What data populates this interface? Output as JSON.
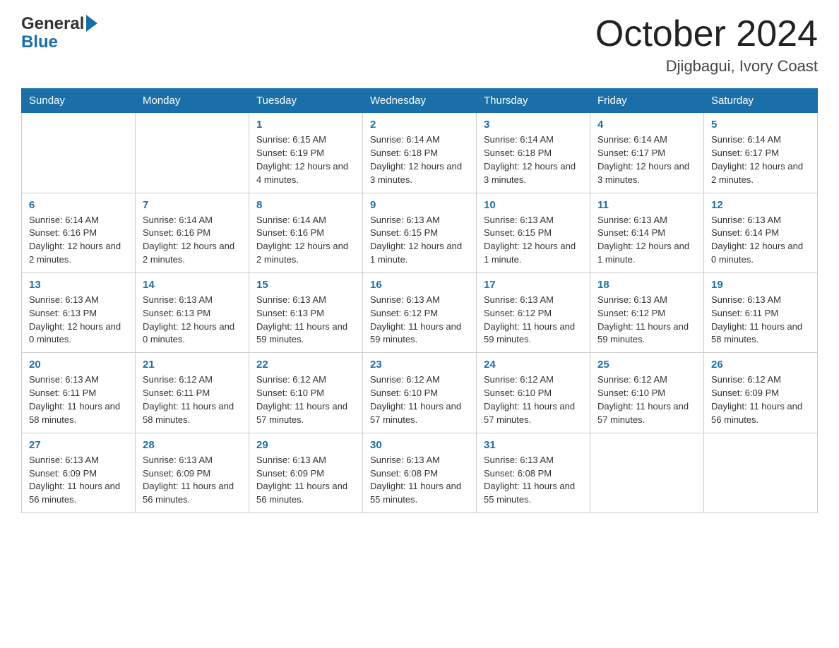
{
  "header": {
    "logo_general": "General",
    "logo_blue": "Blue",
    "month_title": "October 2024",
    "location": "Djigbagui, Ivory Coast"
  },
  "weekdays": [
    "Sunday",
    "Monday",
    "Tuesday",
    "Wednesday",
    "Thursday",
    "Friday",
    "Saturday"
  ],
  "weeks": [
    [
      {
        "day": "",
        "sunrise": "",
        "sunset": "",
        "daylight": ""
      },
      {
        "day": "",
        "sunrise": "",
        "sunset": "",
        "daylight": ""
      },
      {
        "day": "1",
        "sunrise": "Sunrise: 6:15 AM",
        "sunset": "Sunset: 6:19 PM",
        "daylight": "Daylight: 12 hours and 4 minutes."
      },
      {
        "day": "2",
        "sunrise": "Sunrise: 6:14 AM",
        "sunset": "Sunset: 6:18 PM",
        "daylight": "Daylight: 12 hours and 3 minutes."
      },
      {
        "day": "3",
        "sunrise": "Sunrise: 6:14 AM",
        "sunset": "Sunset: 6:18 PM",
        "daylight": "Daylight: 12 hours and 3 minutes."
      },
      {
        "day": "4",
        "sunrise": "Sunrise: 6:14 AM",
        "sunset": "Sunset: 6:17 PM",
        "daylight": "Daylight: 12 hours and 3 minutes."
      },
      {
        "day": "5",
        "sunrise": "Sunrise: 6:14 AM",
        "sunset": "Sunset: 6:17 PM",
        "daylight": "Daylight: 12 hours and 2 minutes."
      }
    ],
    [
      {
        "day": "6",
        "sunrise": "Sunrise: 6:14 AM",
        "sunset": "Sunset: 6:16 PM",
        "daylight": "Daylight: 12 hours and 2 minutes."
      },
      {
        "day": "7",
        "sunrise": "Sunrise: 6:14 AM",
        "sunset": "Sunset: 6:16 PM",
        "daylight": "Daylight: 12 hours and 2 minutes."
      },
      {
        "day": "8",
        "sunrise": "Sunrise: 6:14 AM",
        "sunset": "Sunset: 6:16 PM",
        "daylight": "Daylight: 12 hours and 2 minutes."
      },
      {
        "day": "9",
        "sunrise": "Sunrise: 6:13 AM",
        "sunset": "Sunset: 6:15 PM",
        "daylight": "Daylight: 12 hours and 1 minute."
      },
      {
        "day": "10",
        "sunrise": "Sunrise: 6:13 AM",
        "sunset": "Sunset: 6:15 PM",
        "daylight": "Daylight: 12 hours and 1 minute."
      },
      {
        "day": "11",
        "sunrise": "Sunrise: 6:13 AM",
        "sunset": "Sunset: 6:14 PM",
        "daylight": "Daylight: 12 hours and 1 minute."
      },
      {
        "day": "12",
        "sunrise": "Sunrise: 6:13 AM",
        "sunset": "Sunset: 6:14 PM",
        "daylight": "Daylight: 12 hours and 0 minutes."
      }
    ],
    [
      {
        "day": "13",
        "sunrise": "Sunrise: 6:13 AM",
        "sunset": "Sunset: 6:13 PM",
        "daylight": "Daylight: 12 hours and 0 minutes."
      },
      {
        "day": "14",
        "sunrise": "Sunrise: 6:13 AM",
        "sunset": "Sunset: 6:13 PM",
        "daylight": "Daylight: 12 hours and 0 minutes."
      },
      {
        "day": "15",
        "sunrise": "Sunrise: 6:13 AM",
        "sunset": "Sunset: 6:13 PM",
        "daylight": "Daylight: 11 hours and 59 minutes."
      },
      {
        "day": "16",
        "sunrise": "Sunrise: 6:13 AM",
        "sunset": "Sunset: 6:12 PM",
        "daylight": "Daylight: 11 hours and 59 minutes."
      },
      {
        "day": "17",
        "sunrise": "Sunrise: 6:13 AM",
        "sunset": "Sunset: 6:12 PM",
        "daylight": "Daylight: 11 hours and 59 minutes."
      },
      {
        "day": "18",
        "sunrise": "Sunrise: 6:13 AM",
        "sunset": "Sunset: 6:12 PM",
        "daylight": "Daylight: 11 hours and 59 minutes."
      },
      {
        "day": "19",
        "sunrise": "Sunrise: 6:13 AM",
        "sunset": "Sunset: 6:11 PM",
        "daylight": "Daylight: 11 hours and 58 minutes."
      }
    ],
    [
      {
        "day": "20",
        "sunrise": "Sunrise: 6:13 AM",
        "sunset": "Sunset: 6:11 PM",
        "daylight": "Daylight: 11 hours and 58 minutes."
      },
      {
        "day": "21",
        "sunrise": "Sunrise: 6:12 AM",
        "sunset": "Sunset: 6:11 PM",
        "daylight": "Daylight: 11 hours and 58 minutes."
      },
      {
        "day": "22",
        "sunrise": "Sunrise: 6:12 AM",
        "sunset": "Sunset: 6:10 PM",
        "daylight": "Daylight: 11 hours and 57 minutes."
      },
      {
        "day": "23",
        "sunrise": "Sunrise: 6:12 AM",
        "sunset": "Sunset: 6:10 PM",
        "daylight": "Daylight: 11 hours and 57 minutes."
      },
      {
        "day": "24",
        "sunrise": "Sunrise: 6:12 AM",
        "sunset": "Sunset: 6:10 PM",
        "daylight": "Daylight: 11 hours and 57 minutes."
      },
      {
        "day": "25",
        "sunrise": "Sunrise: 6:12 AM",
        "sunset": "Sunset: 6:10 PM",
        "daylight": "Daylight: 11 hours and 57 minutes."
      },
      {
        "day": "26",
        "sunrise": "Sunrise: 6:12 AM",
        "sunset": "Sunset: 6:09 PM",
        "daylight": "Daylight: 11 hours and 56 minutes."
      }
    ],
    [
      {
        "day": "27",
        "sunrise": "Sunrise: 6:13 AM",
        "sunset": "Sunset: 6:09 PM",
        "daylight": "Daylight: 11 hours and 56 minutes."
      },
      {
        "day": "28",
        "sunrise": "Sunrise: 6:13 AM",
        "sunset": "Sunset: 6:09 PM",
        "daylight": "Daylight: 11 hours and 56 minutes."
      },
      {
        "day": "29",
        "sunrise": "Sunrise: 6:13 AM",
        "sunset": "Sunset: 6:09 PM",
        "daylight": "Daylight: 11 hours and 56 minutes."
      },
      {
        "day": "30",
        "sunrise": "Sunrise: 6:13 AM",
        "sunset": "Sunset: 6:08 PM",
        "daylight": "Daylight: 11 hours and 55 minutes."
      },
      {
        "day": "31",
        "sunrise": "Sunrise: 6:13 AM",
        "sunset": "Sunset: 6:08 PM",
        "daylight": "Daylight: 11 hours and 55 minutes."
      },
      {
        "day": "",
        "sunrise": "",
        "sunset": "",
        "daylight": ""
      },
      {
        "day": "",
        "sunrise": "",
        "sunset": "",
        "daylight": ""
      }
    ]
  ]
}
